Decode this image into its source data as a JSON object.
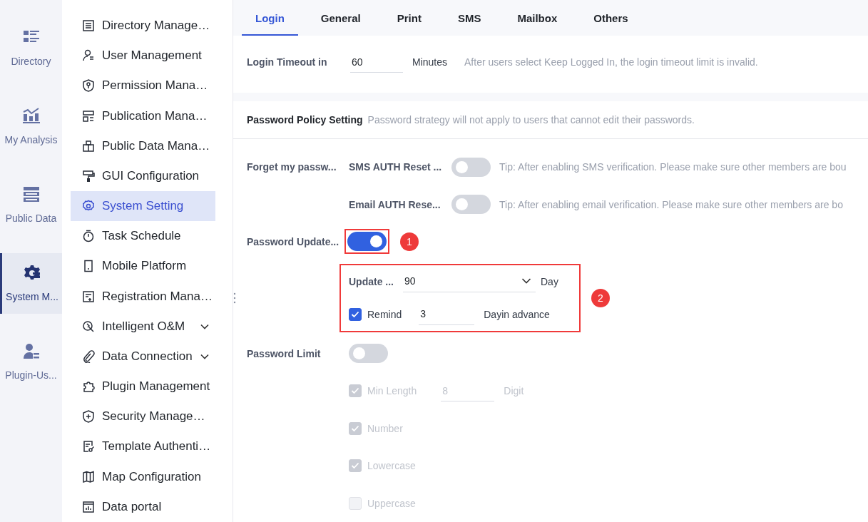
{
  "rail": {
    "items": [
      {
        "label": "Directory",
        "selected": false
      },
      {
        "label": "My Analysis",
        "selected": false
      },
      {
        "label": "Public Data",
        "selected": false
      },
      {
        "label": "System M...",
        "selected": true
      },
      {
        "label": "Plugin-Us...",
        "selected": false
      }
    ]
  },
  "nav": {
    "items": [
      {
        "label": "Directory Manage…",
        "selected": false,
        "expandable": false
      },
      {
        "label": "User Management",
        "selected": false,
        "expandable": false
      },
      {
        "label": "Permission Mana…",
        "selected": false,
        "expandable": false
      },
      {
        "label": "Publication Mana…",
        "selected": false,
        "expandable": false
      },
      {
        "label": "Public Data Mana…",
        "selected": false,
        "expandable": false
      },
      {
        "label": "GUI Configuration",
        "selected": false,
        "expandable": false
      },
      {
        "label": "System Setting",
        "selected": true,
        "expandable": false
      },
      {
        "label": "Task Schedule",
        "selected": false,
        "expandable": false
      },
      {
        "label": "Mobile Platform",
        "selected": false,
        "expandable": false
      },
      {
        "label": "Registration Mana…",
        "selected": false,
        "expandable": false
      },
      {
        "label": "Intelligent O&M",
        "selected": false,
        "expandable": true
      },
      {
        "label": "Data Connection",
        "selected": false,
        "expandable": true
      },
      {
        "label": "Plugin Management",
        "selected": false,
        "expandable": false
      },
      {
        "label": "Security Manage…",
        "selected": false,
        "expandable": false
      },
      {
        "label": "Template Authenti…",
        "selected": false,
        "expandable": false
      },
      {
        "label": "Map Configuration",
        "selected": false,
        "expandable": false
      },
      {
        "label": "Data portal",
        "selected": false,
        "expandable": false
      }
    ]
  },
  "tabs": [
    {
      "label": "Login",
      "selected": true
    },
    {
      "label": "General",
      "selected": false
    },
    {
      "label": "Print",
      "selected": false
    },
    {
      "label": "SMS",
      "selected": false
    },
    {
      "label": "Mailbox",
      "selected": false
    },
    {
      "label": "Others",
      "selected": false
    }
  ],
  "login_timeout": {
    "label": "Login Timeout in",
    "value": "60",
    "unit": "Minutes",
    "hint": "After users select Keep Logged In, the login timeout limit is invalid."
  },
  "password_policy": {
    "title": "Password Policy Setting",
    "hint": "Password strategy will not apply to users that cannot edit their passwords."
  },
  "forget_password": {
    "label": "Forget my passw...",
    "options": [
      {
        "label": "SMS AUTH Reset ...",
        "on": false,
        "tip": "Tip: After enabling SMS verification. Please make sure other members are bou"
      },
      {
        "label": "Email AUTH Rese...",
        "on": false,
        "tip": "Tip: After enabling email verification. Please make sure other members are bo"
      }
    ]
  },
  "password_update": {
    "label": "Password Update...",
    "on": true,
    "annotation": "1",
    "frequency": {
      "label": "Update ...",
      "value": "90",
      "unit": "Day"
    },
    "remind": {
      "checked": true,
      "label": "Remind",
      "value": "3",
      "unit": "Dayin advance"
    },
    "settings_annotation": "2"
  },
  "password_limit": {
    "label": "Password Limit",
    "on": false,
    "rules": [
      {
        "label": "Min Length",
        "checked": true,
        "disabled": true,
        "value": "8",
        "unit": "Digit"
      },
      {
        "label": "Number",
        "checked": true,
        "disabled": true
      },
      {
        "label": "Lowercase",
        "checked": true,
        "disabled": true
      },
      {
        "label": "Uppercase",
        "checked": false,
        "disabled": true
      }
    ]
  }
}
